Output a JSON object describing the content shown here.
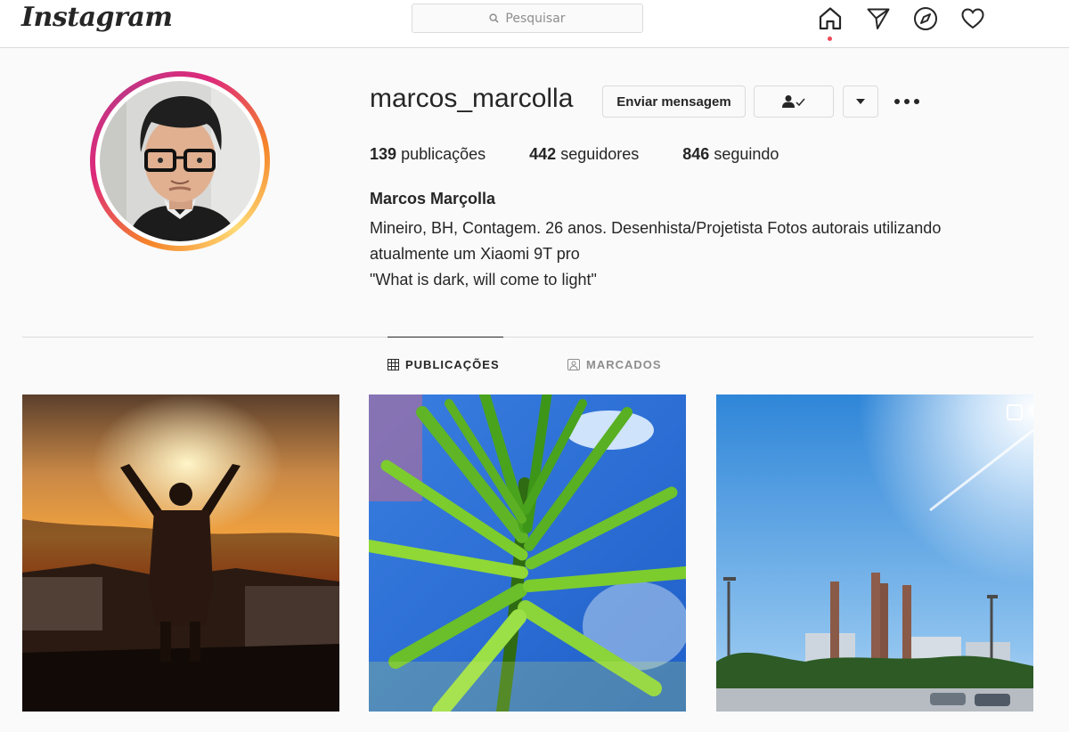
{
  "header": {
    "logo": "Instagram",
    "search_placeholder": "Pesquisar",
    "icons": [
      "home-icon",
      "direct-icon",
      "explore-icon",
      "activity-heart-icon"
    ]
  },
  "profile": {
    "username": "marcos_marcolla",
    "message_button": "Enviar mensagem",
    "stats": {
      "posts_count": "139",
      "posts_label": "publicações",
      "followers_count": "442",
      "followers_label": "seguidores",
      "following_count": "846",
      "following_label": "seguindo"
    },
    "full_name": "Marcos Marçolla",
    "bio_lines": [
      "Mineiro, BH, Contagem. 26 anos. Desenhista/Projetista Fotos autorais utilizando",
      "atualmente um Xiaomi 9T pro",
      "\"What is dark, will come to light\""
    ]
  },
  "tabs": [
    {
      "label": "PUBLICAÇÕES",
      "active": true
    },
    {
      "label": "MARCADOS",
      "active": false
    }
  ],
  "colors": {
    "accent_red": "#ed4956",
    "border": "#dbdbdb",
    "muted": "#8e8e8e"
  }
}
